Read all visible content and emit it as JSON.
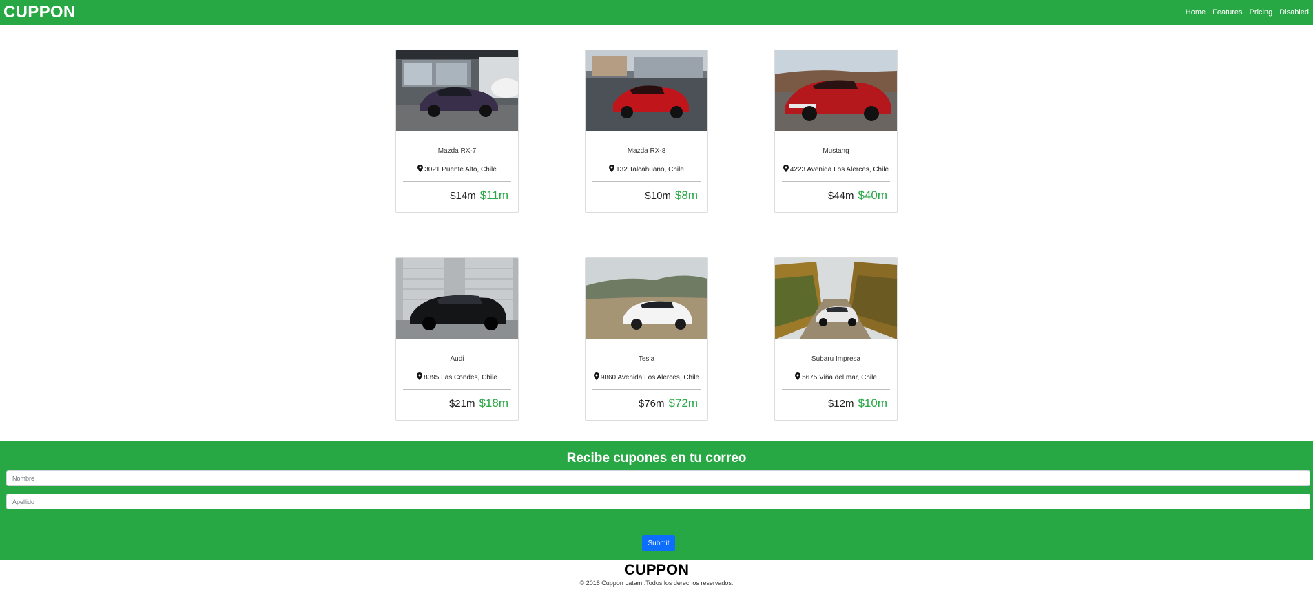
{
  "navbar": {
    "brand": "CUPPON",
    "links": [
      "Home",
      "Features",
      "Pricing",
      "Disabled"
    ]
  },
  "cards": [
    {
      "title": "Mazda RX-7",
      "location": "3021 Puente Alto, Chile",
      "old_price": "$14m",
      "new_price": "$11m"
    },
    {
      "title": "Mazda RX-8",
      "location": "132 Talcahuano, Chile",
      "old_price": "$10m",
      "new_price": "$8m"
    },
    {
      "title": "Mustang",
      "location": "4223 Avenida Los Alerces, Chile",
      "old_price": "$44m",
      "new_price": "$40m"
    },
    {
      "title": "Audi",
      "location": "8395 Las Condes, Chile",
      "old_price": "$21m",
      "new_price": "$18m"
    },
    {
      "title": "Tesla",
      "location": "9860 Avenida Los Alerces, Chile",
      "old_price": "$76m",
      "new_price": "$72m"
    },
    {
      "title": "Subaru Impresa",
      "location": "5675 Viña del mar, Chile",
      "old_price": "$12m",
      "new_price": "$10m"
    }
  ],
  "newsletter": {
    "title": "Recibe cupones en tu correo",
    "first_name_placeholder": "Nombre",
    "last_name_placeholder": "Apellido",
    "submit_label": "Submit"
  },
  "footer": {
    "brand": "CUPPON",
    "copyright": "© 2018 Cuppon Latam .Todos los derechos reservados."
  },
  "colors": {
    "brand_green": "#28a745",
    "submit_blue": "#0d6efd"
  },
  "icons": [
    "map-marker-icon"
  ]
}
